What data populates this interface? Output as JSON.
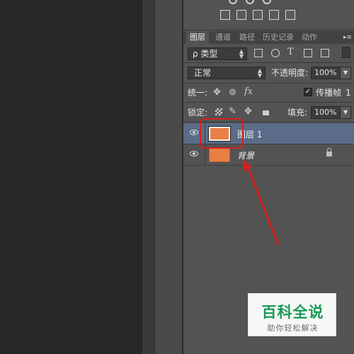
{
  "panel": {
    "tabs": [
      {
        "label": "图层",
        "active": true
      },
      {
        "label": "通道",
        "active": false
      },
      {
        "label": "路径",
        "active": false
      },
      {
        "label": "历史记录",
        "active": false
      },
      {
        "label": "动作",
        "active": false
      }
    ],
    "menu_glyph": "▸≡",
    "filter": {
      "label": "ρ 类型",
      "icons": [
        "image-filter-icon",
        "adjustment-filter-icon",
        "type-filter-icon",
        "shape-filter-icon",
        "smart-object-filter-icon"
      ],
      "type_glyph": "T"
    },
    "blend": {
      "mode": "正常",
      "opacity_label": "不透明度:",
      "opacity_value": "100%"
    },
    "unify": {
      "label": "统一:",
      "fx": "fx",
      "propagate_label": "传播帧",
      "propagate_value": "1",
      "propagate_checked": true
    },
    "lock": {
      "label": "锁定:",
      "fill_label": "填充:",
      "fill_value": "100%"
    },
    "layers": [
      {
        "name": "图层 1",
        "visible": true,
        "selected": true,
        "locked": false,
        "color": "#ea7f46"
      },
      {
        "name": "背景",
        "visible": true,
        "selected": false,
        "locked": true,
        "color": "#ea7f46"
      }
    ]
  },
  "watermark": {
    "title": "百科全说",
    "subtitle": "助你轻松解决"
  },
  "colors": {
    "accent": "#5a6c87",
    "annotation": "#d62020",
    "layer_fill": "#ea7f46",
    "brand": "#1a9a57"
  }
}
